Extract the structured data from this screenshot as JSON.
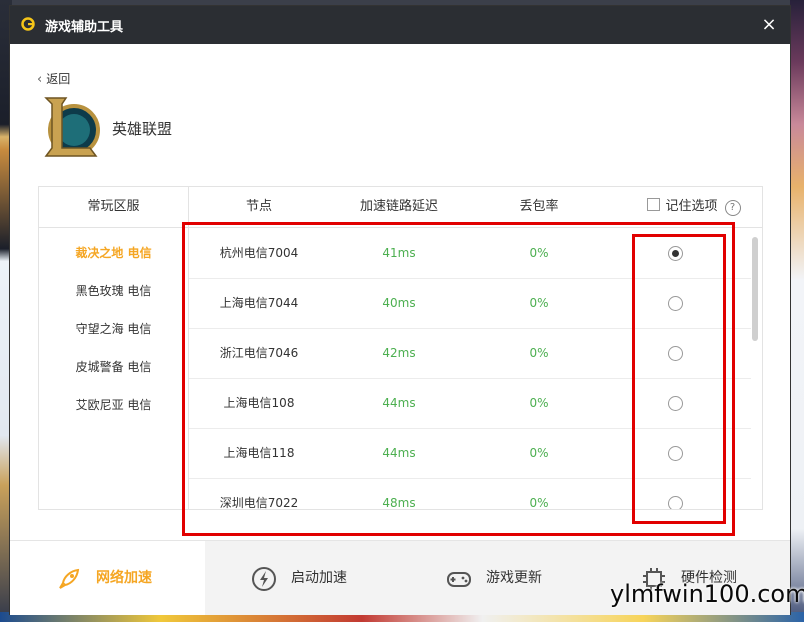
{
  "app": {
    "title": "游戏辅助工具",
    "close_glyph": "×"
  },
  "nav": {
    "back_label": "返回"
  },
  "game": {
    "name": "英雄联盟"
  },
  "regions": {
    "header": "常玩区服",
    "items": [
      {
        "label": "裁决之地 电信",
        "active": true
      },
      {
        "label": "黑色玫瑰 电信",
        "active": false
      },
      {
        "label": "守望之海 电信",
        "active": false
      },
      {
        "label": "皮城警备 电信",
        "active": false
      },
      {
        "label": "艾欧尼亚 电信",
        "active": false
      }
    ]
  },
  "table": {
    "headers": {
      "node": "节点",
      "latency": "加速链路延迟",
      "loss": "丢包率",
      "remember": "记住选项",
      "help": "?"
    },
    "rows": [
      {
        "node": "杭州电信7004",
        "latency": "41ms",
        "loss": "0%",
        "selected": true
      },
      {
        "node": "上海电信7044",
        "latency": "40ms",
        "loss": "0%",
        "selected": false
      },
      {
        "node": "浙江电信7046",
        "latency": "42ms",
        "loss": "0%",
        "selected": false
      },
      {
        "node": "上海电信108",
        "latency": "44ms",
        "loss": "0%",
        "selected": false
      },
      {
        "node": "上海电信118",
        "latency": "44ms",
        "loss": "0%",
        "selected": false
      },
      {
        "node": "深圳电信7022",
        "latency": "48ms",
        "loss": "0%",
        "selected": false
      }
    ]
  },
  "bottom_nav": {
    "items": [
      {
        "label": "网络加速",
        "icon": "rocket-icon",
        "active": true
      },
      {
        "label": "启动加速",
        "icon": "lightning-icon",
        "active": false
      },
      {
        "label": "游戏更新",
        "icon": "gamepad-icon",
        "active": false
      },
      {
        "label": "硬件检测",
        "icon": "chip-icon",
        "active": false
      }
    ]
  },
  "watermark": {
    "text": "ylmfwin100.com"
  },
  "colors": {
    "accent": "#f5a623",
    "good": "#4caf50",
    "highlight": "#e10000",
    "titlebar": "#2b2e33"
  }
}
